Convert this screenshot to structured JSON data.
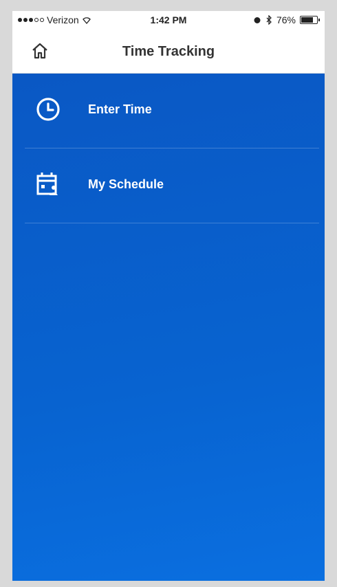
{
  "status_bar": {
    "carrier": "Verizon",
    "time": "1:42 PM",
    "battery": "76%",
    "battery_level": 0.76
  },
  "header": {
    "title": "Time Tracking",
    "home_icon": "home-icon"
  },
  "menu": [
    {
      "label": "Enter Time",
      "icon": "clock-icon"
    },
    {
      "label": "My Schedule",
      "icon": "calendar-person-icon"
    }
  ],
  "colors": {
    "content_background": "#0863d0",
    "menu_text": "#ffffff",
    "nav_background": "#ffffff"
  }
}
